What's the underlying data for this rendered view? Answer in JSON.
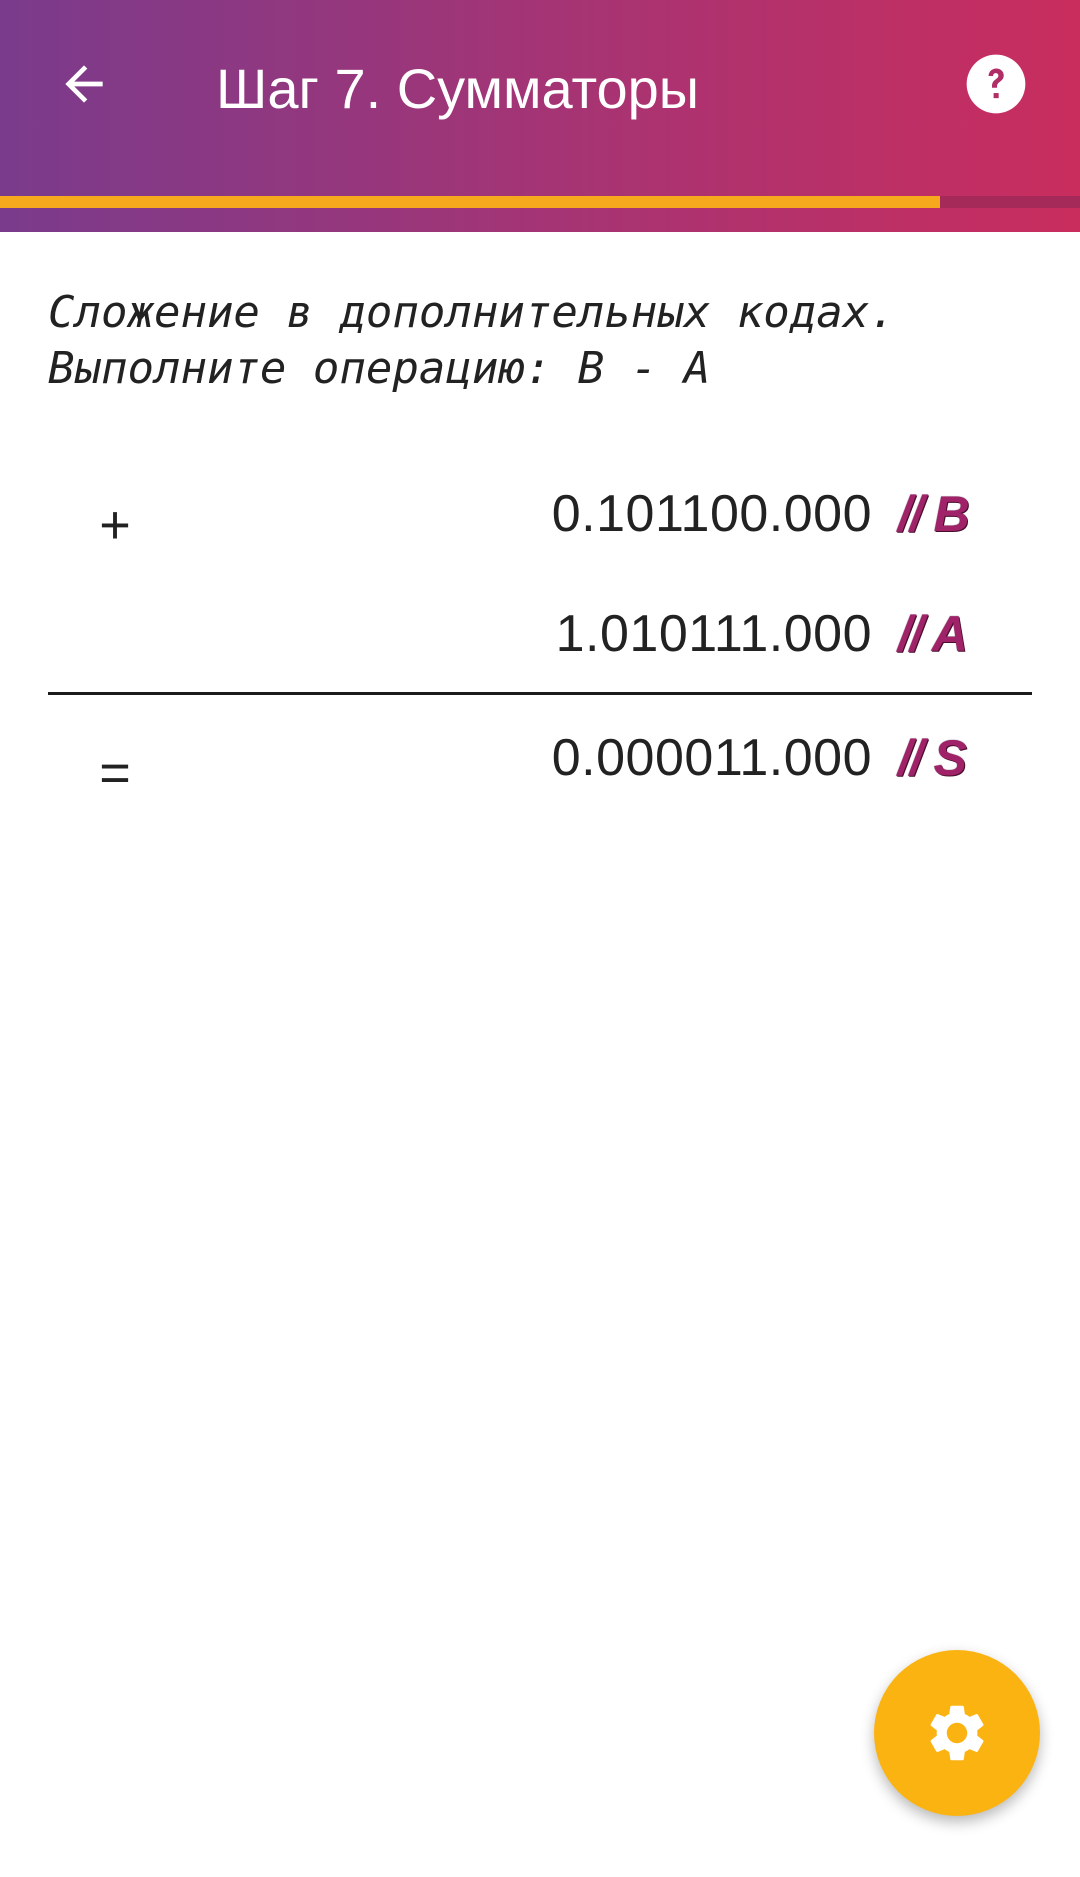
{
  "app_bar": {
    "title": "Шаг 7. Сумматоры",
    "back_icon": "arrow-left-icon",
    "help_icon": "help-circle-icon",
    "gradient_colors": [
      "#7a3b8c",
      "#c92d5e"
    ]
  },
  "progress": {
    "value": 0.87,
    "fill_color": "#f7a91d"
  },
  "task": {
    "line1": "Сложение в дополнительных кодах.",
    "line2": "Выполните операцию: B - A"
  },
  "calculation": {
    "plus_sign": "+",
    "equals_sign": "=",
    "operand_b": {
      "value": "0.101100.000",
      "comment": "// B"
    },
    "operand_a": {
      "value": "1.010111.000",
      "comment": "// A"
    },
    "result": {
      "value": "0.000011.000",
      "comment": "// S"
    }
  },
  "fab": {
    "icon": "gear-icon",
    "color": "#fbb312"
  }
}
